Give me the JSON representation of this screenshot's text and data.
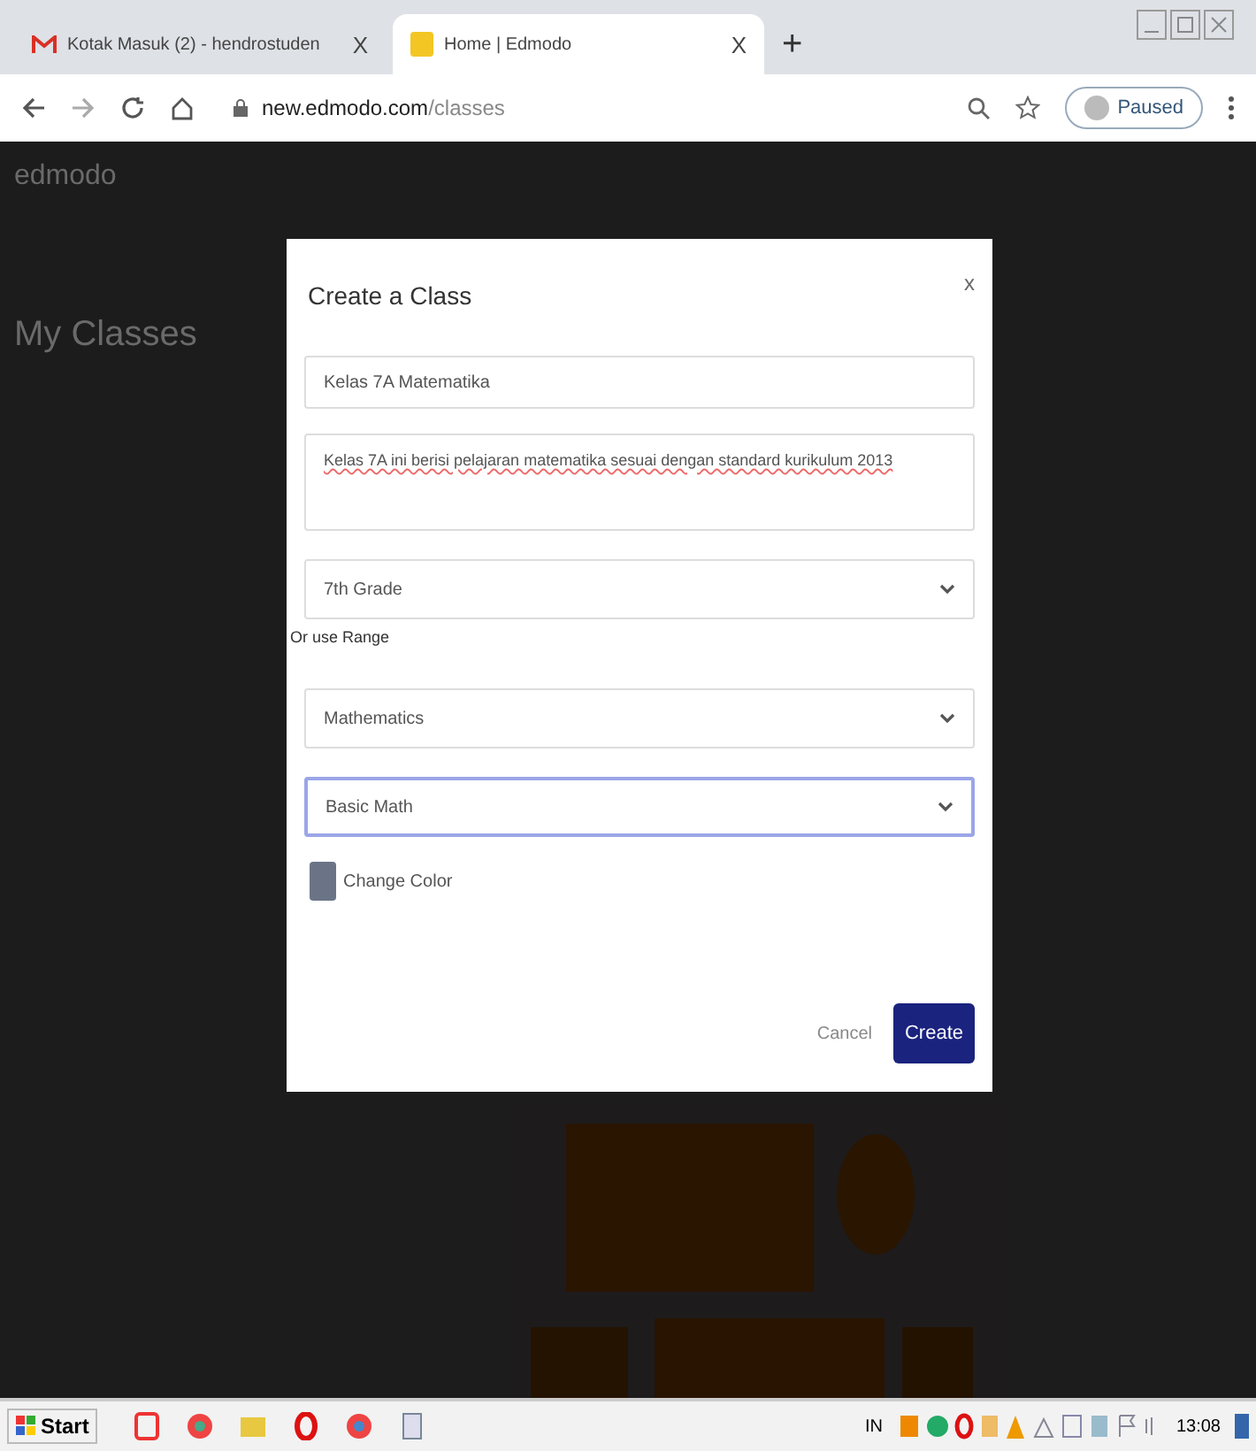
{
  "browser": {
    "tabs": [
      {
        "title": "Kotak Masuk (2) - hendrostuden",
        "close": "X",
        "kind": "mail",
        "selected": false
      },
      {
        "title": "Home | Edmodo",
        "close": "X",
        "kind": "site",
        "selected": true
      }
    ],
    "new_tab": "+",
    "url_host": "new.edmodo.com",
    "url_path": "/classes",
    "profile": "Paused"
  },
  "page": {
    "logo": "edmodo",
    "heading": "My Classes"
  },
  "dialog": {
    "title": "Create a Class",
    "close": "x",
    "fields": [
      {
        "kind": "input",
        "value": "Kelas 7A Matematika",
        "focused": false
      },
      {
        "kind": "textarea",
        "value": "Kelas 7A ini berisi pelajaran matematika sesuai dengan standard kurikulum 2013",
        "focused": false
      },
      {
        "kind": "select",
        "value": "7th Grade",
        "focused": false
      },
      {
        "kind": "link",
        "value": "Or use Range"
      },
      {
        "kind": "select",
        "value": "Mathematics",
        "focused": false
      },
      {
        "kind": "select",
        "value": "Basic Math",
        "focused": true
      }
    ],
    "color": {
      "color": "#6b7486",
      "label": "Change Color"
    },
    "cancel": "Cancel",
    "create": "Create"
  },
  "taskbar": {
    "start": "Start",
    "language": "IN",
    "clock": "13:08"
  }
}
